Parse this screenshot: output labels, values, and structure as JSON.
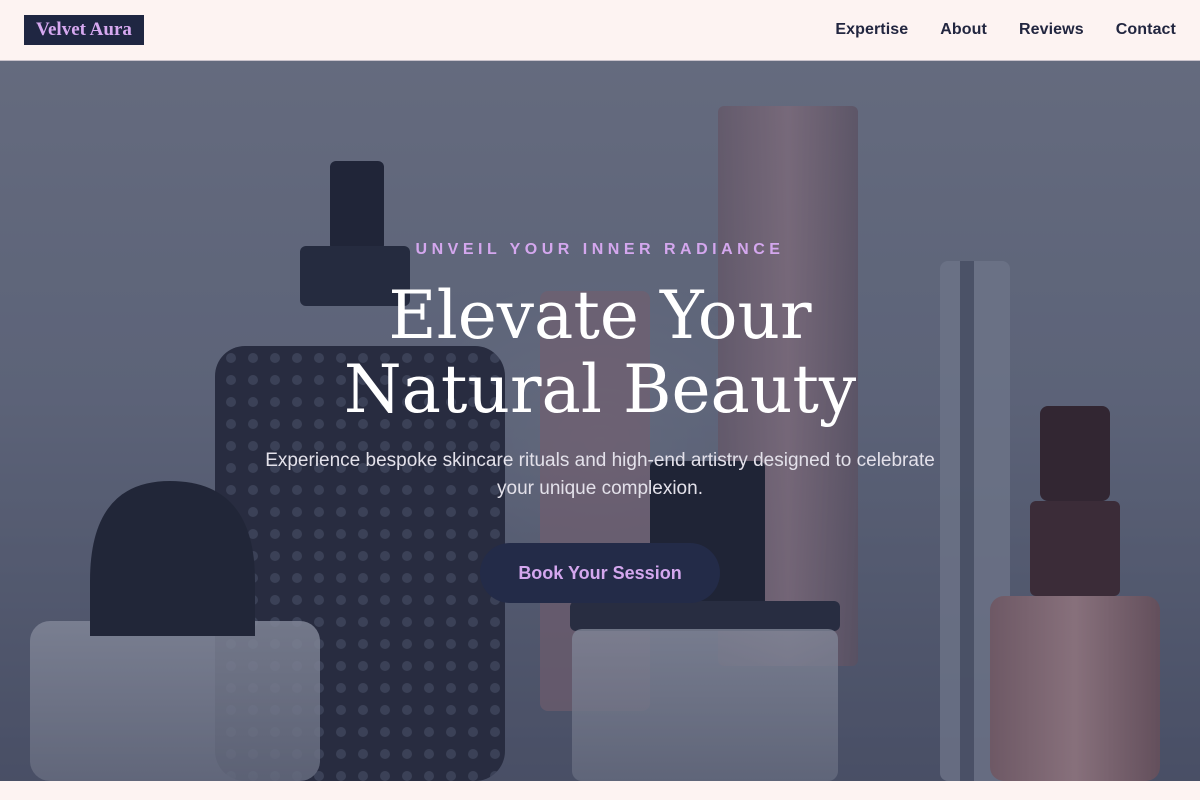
{
  "brand": {
    "name": "Velvet Aura"
  },
  "nav": {
    "items": [
      "Expertise",
      "About",
      "Reviews",
      "Contact"
    ]
  },
  "hero": {
    "eyebrow": "UNVEIL YOUR INNER RADIANCE",
    "headline": "Elevate Your Natural Beauty",
    "subtext": "Experience bespoke skincare rituals and high-end artistry designed to celebrate your unique complexion.",
    "cta_label": "Book Your Session"
  },
  "colors": {
    "header_bg": "#fdf3f2",
    "logo_bg": "#1f2642",
    "accent_lilac": "#d4a7ee",
    "nav_text": "#222640",
    "cta_bg": "#232b48",
    "headline_text": "#ffffff"
  }
}
